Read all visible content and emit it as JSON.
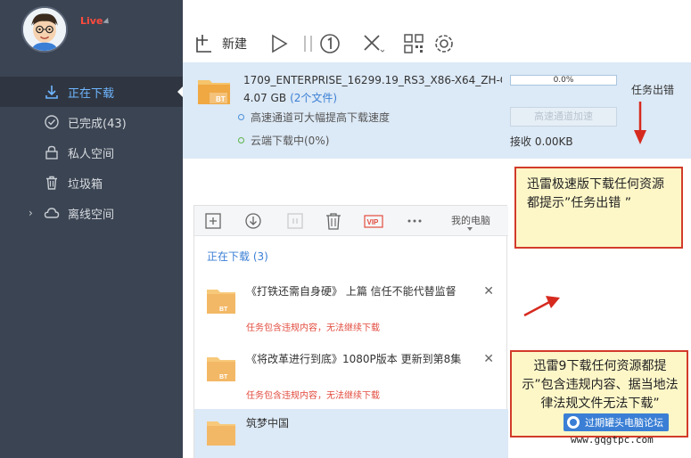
{
  "sidebar": {
    "user_badge": "Live",
    "items": [
      {
        "label": "正在下载",
        "icon": "download-icon",
        "active": true
      },
      {
        "label": "已完成(43)",
        "icon": "check-circle-icon",
        "active": false
      },
      {
        "label": "私人空间",
        "icon": "lock-icon",
        "active": false
      },
      {
        "label": "垃圾箱",
        "icon": "trash-icon",
        "active": false
      },
      {
        "label": "离线空间",
        "icon": "cloud-icon",
        "active": false
      }
    ]
  },
  "toolbar": {
    "new_label": "新建"
  },
  "task": {
    "name": "1709_ENTERPRISE_16299.19_RS3_X86-X64_ZH-CN...",
    "size": "4.07 GB",
    "files": "(2个文件)",
    "progress_text": "0.0%",
    "progress": 0.0,
    "tip": "高速通道可大幅提高下载速度",
    "cloud": "云端下载中(0%)",
    "highspeed_button": "高速通道加速",
    "receive": "接收 0.00KB",
    "status": "任务出错"
  },
  "notes": {
    "top": "迅雷极速版下载任何资源都提示”任务出错 ”",
    "bottom": "迅雷9下载任何资源都提示”包含违规内容、据当地法律法规文件无法下载”"
  },
  "sub": {
    "mypc": "我的电脑",
    "section": "正在下载 (3)",
    "items": [
      {
        "title": "《打铁还需自身硬》 上篇 信任不能代替监督",
        "warn": "任务包含违规内容，无法继续下载"
      },
      {
        "title": "《将改革进行到底》1080P版本 更新到第8集",
        "warn": "任务包含违规内容，无法继续下载"
      },
      {
        "title": "筑梦中国",
        "warn": ""
      }
    ]
  },
  "watermark": {
    "logo_text": "过期罐头电脑论坛",
    "url": "www.gqgtpc.com"
  },
  "colors": {
    "sidebar_bg": "#3b4452",
    "accent": "#3a7fd5",
    "warn": "#e24c3f",
    "annotation_border": "#d23b2a"
  }
}
